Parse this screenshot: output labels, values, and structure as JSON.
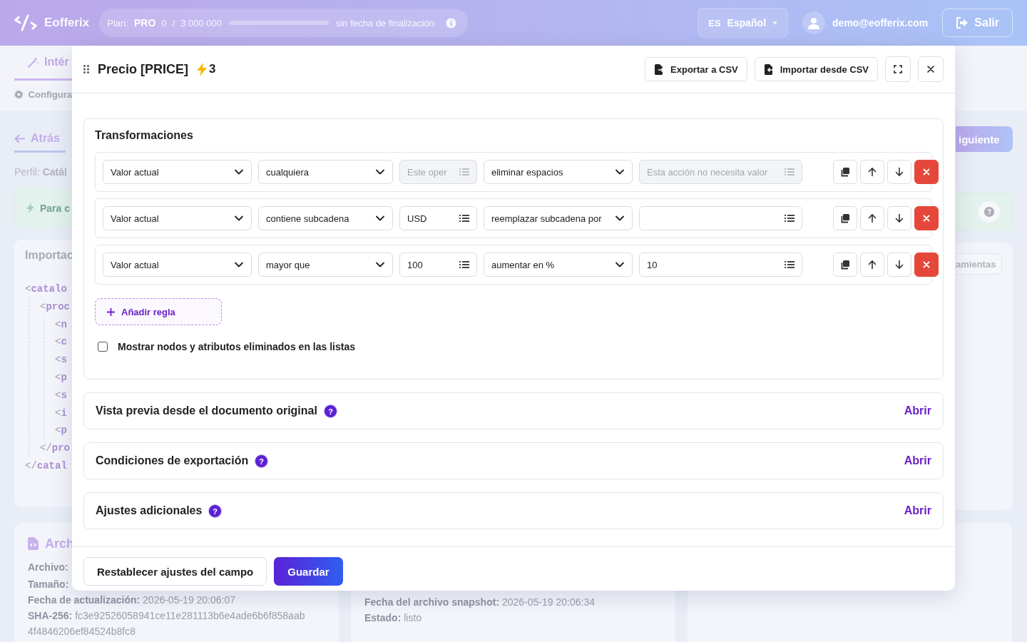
{
  "topbar": {
    "brand": "Eofferix",
    "plan": {
      "label": "Plan:",
      "name": "PRO",
      "used": "0",
      "separator": "/",
      "limit": "3 000 000",
      "level": 0,
      "expiry": "sin fecha de finalización"
    },
    "language": {
      "code": "ES",
      "name": "Español"
    },
    "user": "demo@eofferix.com",
    "logout": "Salir"
  },
  "background": {
    "tabs": [
      {
        "label": "Intér",
        "selected": true
      }
    ],
    "subtab": "Configura",
    "back": "Atrás",
    "profile": {
      "label": "Perfil:",
      "value": "Catál"
    },
    "notice": "Para c",
    "import_card": {
      "title": "Importac",
      "xml_tree": [
        {
          "open": "<",
          "tag": "catalo",
          "close_open": "</",
          "close_tag": "catal",
          "children": [
            {
              "open": "<",
              "tag": "proc",
              "close_open": "</",
              "close_tag": "pro",
              "children": [
                {
                  "open": "<",
                  "tag": "n"
                },
                {
                  "open": "<",
                  "tag": "c"
                },
                {
                  "open": "<",
                  "tag": "s"
                },
                {
                  "open": "<",
                  "tag": "p"
                },
                {
                  "open": "<",
                  "tag": "s"
                },
                {
                  "open": "<",
                  "tag": "i"
                },
                {
                  "open": "<",
                  "tag": "p"
                }
              ]
            }
          ]
        }
      ]
    },
    "next_button": "iguiente",
    "tools_button": "amientas",
    "cards": [
      {
        "title": "Arch",
        "fields": [
          {
            "label": "Archivo:"
          },
          {
            "label": "Tamaño:"
          },
          {
            "label": "Fecha de actualización:",
            "value": "2026-05-19 20:06:07"
          },
          {
            "label": "SHA-256:",
            "value": "fc3e92526058941ce11e281113b6e4ade6b6f858aab"
          },
          {
            "value": "4f4846206ef84524b8fc8"
          }
        ]
      },
      {
        "fields": [
          {
            "label": "Fecha del archivo snapshot:",
            "value": "2026-05-19 20:06:34"
          },
          {
            "label": "Estado:",
            "value": "listo"
          }
        ]
      }
    ],
    "help_icon": "?"
  },
  "modal": {
    "title": "Precio [PRICE]",
    "badge": "3",
    "header_buttons": [
      "Exportar a CSV",
      "Importar desde CSV"
    ],
    "transformations": {
      "title": "Transformaciones",
      "rules": [
        {
          "source": "Valor actual",
          "condition": "cualquiera",
          "value": {
            "placeholder": "Este oper",
            "disabled": true
          },
          "action": "eliminar espacios",
          "argument": {
            "placeholder": "Esta acción no necesita valor",
            "disabled": true
          }
        },
        {
          "source": "Valor actual",
          "condition": "contiene subcadena",
          "value": {
            "value": "USD",
            "disabled": false
          },
          "action": "reemplazar subcadena por",
          "argument": {
            "disabled": false
          }
        },
        {
          "source": "Valor actual",
          "condition": "mayor que",
          "value": {
            "value": "100",
            "disabled": false
          },
          "action": "aumentar en %",
          "argument": {
            "value": "10",
            "disabled": false
          }
        }
      ],
      "add_rule": "Añadir regla",
      "checkbox": {
        "label": "Mostrar nodos y atributos eliminados en las listas",
        "checked": false
      }
    },
    "sections": [
      {
        "title": "Vista previa desde el documento original",
        "help": "?",
        "action": "Abrir"
      },
      {
        "title": "Condiciones de exportación",
        "help": "?",
        "action": "Abrir"
      },
      {
        "title": "Ajustes adicionales",
        "help": "?",
        "action": "Abrir"
      }
    ],
    "footer": {
      "reset": "Restablecer ajustes del campo",
      "save": "Guardar"
    }
  }
}
